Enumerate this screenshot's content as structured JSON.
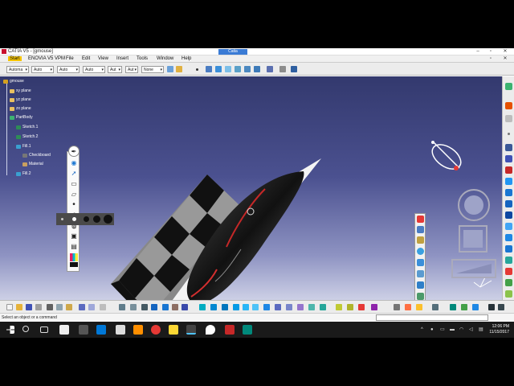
{
  "window": {
    "title": "CATIA V5 - [gmouse]",
    "brand": "Catia",
    "min": "–",
    "max": "▫",
    "close": "✕",
    "inner_max": "▫",
    "inner_close": "✕"
  },
  "menu": {
    "items": [
      "Start",
      "ENOVIA V5 VPM",
      "File",
      "Edit",
      "View",
      "Insert",
      "Tools",
      "Window",
      "Help"
    ]
  },
  "toolbar": {
    "combos": [
      "Automa",
      "Auto",
      "Auto",
      "Auto",
      "Aut",
      "Aut",
      "None"
    ]
  },
  "tree": {
    "items": [
      {
        "label": "gmouse",
        "icon": "product-icon"
      },
      {
        "label": "xy plane",
        "icon": "plane-icon"
      },
      {
        "label": "yz plane",
        "icon": "plane-icon"
      },
      {
        "label": "zx plane",
        "icon": "plane-icon"
      },
      {
        "label": "PartBody",
        "icon": "partbody-icon"
      },
      {
        "label": "Sketch.1",
        "icon": "sketch-icon"
      },
      {
        "label": "Sketch.2",
        "icon": "sketch-icon"
      },
      {
        "label": "Fill.1",
        "icon": "fill-icon"
      },
      {
        "label": "Checkboard",
        "icon": "texture-icon"
      },
      {
        "label": "Material",
        "icon": "material-icon"
      },
      {
        "label": "Fill.2",
        "icon": "fill-icon"
      }
    ]
  },
  "status": {
    "message": "Select an object or a command"
  },
  "clock": {
    "time": "12:06 PM",
    "date": "11/15/2017"
  },
  "colors": {
    "viewport_top": "#33396e",
    "viewport_bottom": "#cdd0e6",
    "brand": "#3a7bd5",
    "start_menu": "#f5c400",
    "taskbar": "#1a1a1a"
  }
}
